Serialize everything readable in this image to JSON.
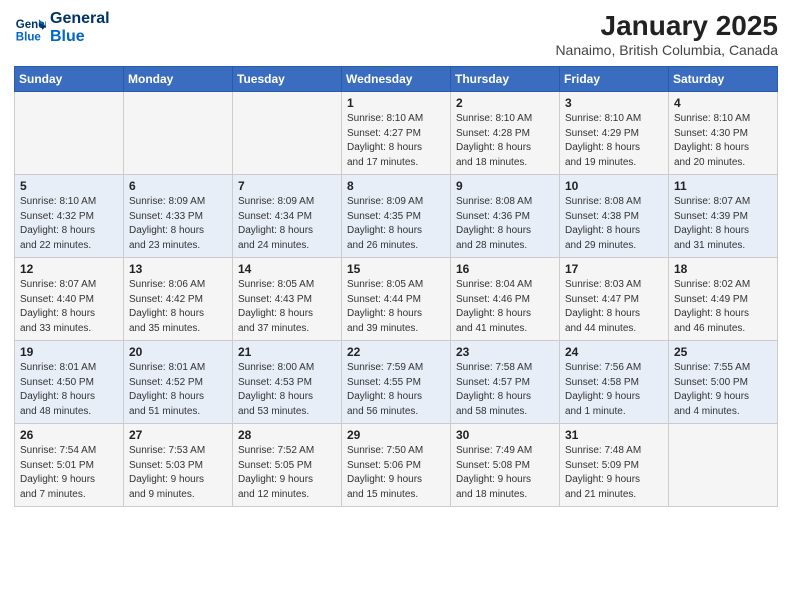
{
  "logo": {
    "line1": "General",
    "line2": "Blue"
  },
  "title": "January 2025",
  "subtitle": "Nanaimo, British Columbia, Canada",
  "weekdays": [
    "Sunday",
    "Monday",
    "Tuesday",
    "Wednesday",
    "Thursday",
    "Friday",
    "Saturday"
  ],
  "weeks": [
    [
      {
        "day": "",
        "info": ""
      },
      {
        "day": "",
        "info": ""
      },
      {
        "day": "",
        "info": ""
      },
      {
        "day": "1",
        "info": "Sunrise: 8:10 AM\nSunset: 4:27 PM\nDaylight: 8 hours\nand 17 minutes."
      },
      {
        "day": "2",
        "info": "Sunrise: 8:10 AM\nSunset: 4:28 PM\nDaylight: 8 hours\nand 18 minutes."
      },
      {
        "day": "3",
        "info": "Sunrise: 8:10 AM\nSunset: 4:29 PM\nDaylight: 8 hours\nand 19 minutes."
      },
      {
        "day": "4",
        "info": "Sunrise: 8:10 AM\nSunset: 4:30 PM\nDaylight: 8 hours\nand 20 minutes."
      }
    ],
    [
      {
        "day": "5",
        "info": "Sunrise: 8:10 AM\nSunset: 4:32 PM\nDaylight: 8 hours\nand 22 minutes."
      },
      {
        "day": "6",
        "info": "Sunrise: 8:09 AM\nSunset: 4:33 PM\nDaylight: 8 hours\nand 23 minutes."
      },
      {
        "day": "7",
        "info": "Sunrise: 8:09 AM\nSunset: 4:34 PM\nDaylight: 8 hours\nand 24 minutes."
      },
      {
        "day": "8",
        "info": "Sunrise: 8:09 AM\nSunset: 4:35 PM\nDaylight: 8 hours\nand 26 minutes."
      },
      {
        "day": "9",
        "info": "Sunrise: 8:08 AM\nSunset: 4:36 PM\nDaylight: 8 hours\nand 28 minutes."
      },
      {
        "day": "10",
        "info": "Sunrise: 8:08 AM\nSunset: 4:38 PM\nDaylight: 8 hours\nand 29 minutes."
      },
      {
        "day": "11",
        "info": "Sunrise: 8:07 AM\nSunset: 4:39 PM\nDaylight: 8 hours\nand 31 minutes."
      }
    ],
    [
      {
        "day": "12",
        "info": "Sunrise: 8:07 AM\nSunset: 4:40 PM\nDaylight: 8 hours\nand 33 minutes."
      },
      {
        "day": "13",
        "info": "Sunrise: 8:06 AM\nSunset: 4:42 PM\nDaylight: 8 hours\nand 35 minutes."
      },
      {
        "day": "14",
        "info": "Sunrise: 8:05 AM\nSunset: 4:43 PM\nDaylight: 8 hours\nand 37 minutes."
      },
      {
        "day": "15",
        "info": "Sunrise: 8:05 AM\nSunset: 4:44 PM\nDaylight: 8 hours\nand 39 minutes."
      },
      {
        "day": "16",
        "info": "Sunrise: 8:04 AM\nSunset: 4:46 PM\nDaylight: 8 hours\nand 41 minutes."
      },
      {
        "day": "17",
        "info": "Sunrise: 8:03 AM\nSunset: 4:47 PM\nDaylight: 8 hours\nand 44 minutes."
      },
      {
        "day": "18",
        "info": "Sunrise: 8:02 AM\nSunset: 4:49 PM\nDaylight: 8 hours\nand 46 minutes."
      }
    ],
    [
      {
        "day": "19",
        "info": "Sunrise: 8:01 AM\nSunset: 4:50 PM\nDaylight: 8 hours\nand 48 minutes."
      },
      {
        "day": "20",
        "info": "Sunrise: 8:01 AM\nSunset: 4:52 PM\nDaylight: 8 hours\nand 51 minutes."
      },
      {
        "day": "21",
        "info": "Sunrise: 8:00 AM\nSunset: 4:53 PM\nDaylight: 8 hours\nand 53 minutes."
      },
      {
        "day": "22",
        "info": "Sunrise: 7:59 AM\nSunset: 4:55 PM\nDaylight: 8 hours\nand 56 minutes."
      },
      {
        "day": "23",
        "info": "Sunrise: 7:58 AM\nSunset: 4:57 PM\nDaylight: 8 hours\nand 58 minutes."
      },
      {
        "day": "24",
        "info": "Sunrise: 7:56 AM\nSunset: 4:58 PM\nDaylight: 9 hours\nand 1 minute."
      },
      {
        "day": "25",
        "info": "Sunrise: 7:55 AM\nSunset: 5:00 PM\nDaylight: 9 hours\nand 4 minutes."
      }
    ],
    [
      {
        "day": "26",
        "info": "Sunrise: 7:54 AM\nSunset: 5:01 PM\nDaylight: 9 hours\nand 7 minutes."
      },
      {
        "day": "27",
        "info": "Sunrise: 7:53 AM\nSunset: 5:03 PM\nDaylight: 9 hours\nand 9 minutes."
      },
      {
        "day": "28",
        "info": "Sunrise: 7:52 AM\nSunset: 5:05 PM\nDaylight: 9 hours\nand 12 minutes."
      },
      {
        "day": "29",
        "info": "Sunrise: 7:50 AM\nSunset: 5:06 PM\nDaylight: 9 hours\nand 15 minutes."
      },
      {
        "day": "30",
        "info": "Sunrise: 7:49 AM\nSunset: 5:08 PM\nDaylight: 9 hours\nand 18 minutes."
      },
      {
        "day": "31",
        "info": "Sunrise: 7:48 AM\nSunset: 5:09 PM\nDaylight: 9 hours\nand 21 minutes."
      },
      {
        "day": "",
        "info": ""
      }
    ]
  ]
}
